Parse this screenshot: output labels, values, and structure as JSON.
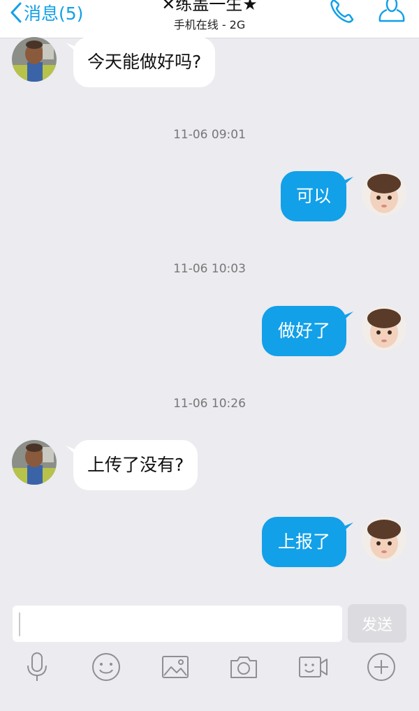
{
  "header": {
    "back_label": "消息(5)",
    "title": "✕练盖一生★",
    "subtitle": "手机在线 - 2G"
  },
  "messages": [
    {
      "direction": "in",
      "text": "今天能做好吗?"
    },
    {
      "timestamp": "11-06 09:01"
    },
    {
      "direction": "out",
      "text": "可以"
    },
    {
      "timestamp": "11-06 10:03"
    },
    {
      "direction": "out",
      "text": "做好了"
    },
    {
      "timestamp": "11-06 10:26"
    },
    {
      "direction": "in",
      "text": "上传了没有?"
    },
    {
      "direction": "out",
      "text": "上报了"
    }
  ],
  "input": {
    "value": "",
    "send_label": "发送"
  },
  "toolbar": [
    "microphone-icon",
    "emoji-icon",
    "image-icon",
    "camera-icon",
    "video-icon",
    "plus-icon"
  ],
  "colors": {
    "accent": "#12a0e8",
    "background": "#ebebf0",
    "bubble_in": "#ffffff",
    "bubble_out": "#12a0e8"
  }
}
